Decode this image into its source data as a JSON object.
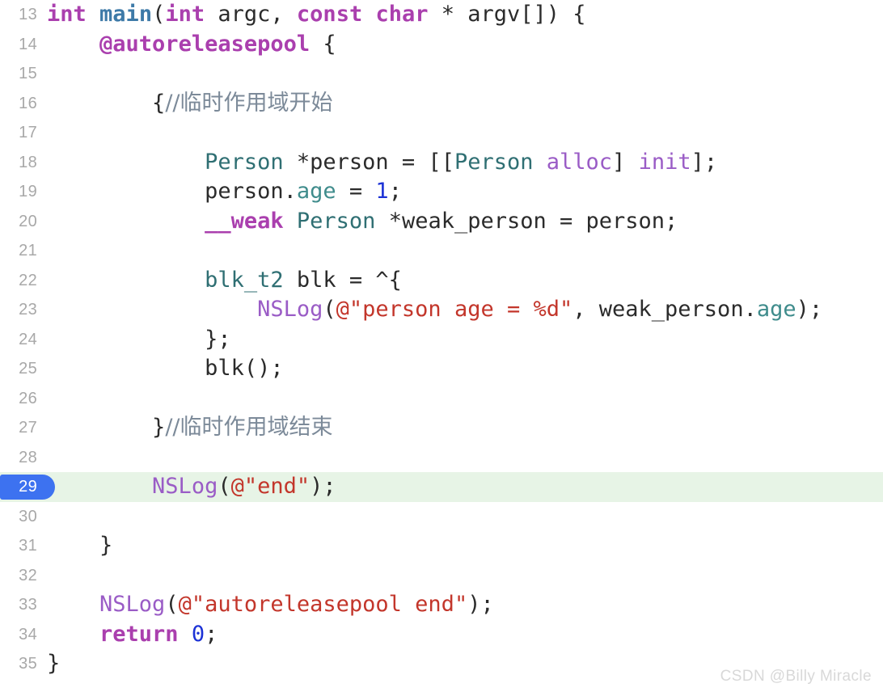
{
  "editor": {
    "language": "Objective-C",
    "first_line": 13,
    "highlighted_line": 29,
    "colors": {
      "background": "#ffffff",
      "highlight_row": "#e7f4e6",
      "breakpoint_badge": "#3d72f0",
      "gutter_text": "#a8a8a8",
      "keyword": "#aa3fae",
      "function_name": "#3e7aa8",
      "type": "#2f6f73",
      "property": "#3f8c8c",
      "message_selector": "#9a5cc6",
      "string": "#c3362b",
      "number": "#1c32d6",
      "comment": "#7c8a99",
      "plain_text": "#2b2b2b",
      "watermark": "#d8d8d8"
    }
  },
  "watermark": {
    "text": "CSDN @Billy Miracle"
  },
  "lines": [
    {
      "num": "13",
      "text": "int main(int argc, const char * argv[]) {"
    },
    {
      "num": "14",
      "text": "    @autoreleasepool {"
    },
    {
      "num": "15",
      "text": ""
    },
    {
      "num": "16",
      "text": "        {//临时作用域开始"
    },
    {
      "num": "17",
      "text": ""
    },
    {
      "num": "18",
      "text": "            Person *person = [[Person alloc] init];"
    },
    {
      "num": "19",
      "text": "            person.age = 1;"
    },
    {
      "num": "20",
      "text": "            __weak Person *weak_person = person;"
    },
    {
      "num": "21",
      "text": ""
    },
    {
      "num": "22",
      "text": "            blk_t2 blk = ^{"
    },
    {
      "num": "23",
      "text": "                NSLog(@\"person age = %d\", weak_person.age);"
    },
    {
      "num": "24",
      "text": "            };"
    },
    {
      "num": "25",
      "text": "            blk();"
    },
    {
      "num": "26",
      "text": ""
    },
    {
      "num": "27",
      "text": "        }//临时作用域结束"
    },
    {
      "num": "28",
      "text": ""
    },
    {
      "num": "29",
      "text": "        NSLog(@\"end\");",
      "highlighted": true
    },
    {
      "num": "30",
      "text": ""
    },
    {
      "num": "31",
      "text": "    }"
    },
    {
      "num": "32",
      "text": ""
    },
    {
      "num": "33",
      "text": "    NSLog(@\"autoreleasepool end\");"
    },
    {
      "num": "34",
      "text": "    return 0;"
    },
    {
      "num": "35",
      "text": "}"
    }
  ],
  "tokens": [
    {
      "num": "13",
      "parts": [
        {
          "t": "int",
          "c": "kw"
        },
        {
          "t": " ",
          "c": "plain"
        },
        {
          "t": "main",
          "c": "fnname"
        },
        {
          "t": "(",
          "c": "plain"
        },
        {
          "t": "int",
          "c": "kw"
        },
        {
          "t": " argc, ",
          "c": "plain"
        },
        {
          "t": "const",
          "c": "kw"
        },
        {
          "t": " ",
          "c": "plain"
        },
        {
          "t": "char",
          "c": "kw"
        },
        {
          "t": " * argv[]) {",
          "c": "plain"
        }
      ]
    },
    {
      "num": "14",
      "parts": [
        {
          "t": "    ",
          "c": "plain"
        },
        {
          "t": "@autoreleasepool",
          "c": "kw"
        },
        {
          "t": " {",
          "c": "plain"
        }
      ]
    },
    {
      "num": "15",
      "parts": []
    },
    {
      "num": "16",
      "parts": [
        {
          "t": "        ",
          "c": "plain"
        },
        {
          "t": "{",
          "c": "plain"
        },
        {
          "t": "//临时作用域开始",
          "c": "cmt"
        }
      ]
    },
    {
      "num": "17",
      "parts": []
    },
    {
      "num": "18",
      "parts": [
        {
          "t": "            ",
          "c": "plain"
        },
        {
          "t": "Person",
          "c": "type"
        },
        {
          "t": " *person = [[",
          "c": "plain"
        },
        {
          "t": "Person",
          "c": "type"
        },
        {
          "t": " ",
          "c": "plain"
        },
        {
          "t": "alloc",
          "c": "msg"
        },
        {
          "t": "] ",
          "c": "plain"
        },
        {
          "t": "init",
          "c": "msg"
        },
        {
          "t": "];",
          "c": "plain"
        }
      ]
    },
    {
      "num": "19",
      "parts": [
        {
          "t": "            person.",
          "c": "plain"
        },
        {
          "t": "age",
          "c": "prop"
        },
        {
          "t": " = ",
          "c": "plain"
        },
        {
          "t": "1",
          "c": "num"
        },
        {
          "t": ";",
          "c": "plain"
        }
      ]
    },
    {
      "num": "20",
      "parts": [
        {
          "t": "            ",
          "c": "plain"
        },
        {
          "t": "__weak",
          "c": "kw"
        },
        {
          "t": " ",
          "c": "plain"
        },
        {
          "t": "Person",
          "c": "type"
        },
        {
          "t": " *weak_person = person;",
          "c": "plain"
        }
      ]
    },
    {
      "num": "21",
      "parts": []
    },
    {
      "num": "22",
      "parts": [
        {
          "t": "            ",
          "c": "plain"
        },
        {
          "t": "blk_t2",
          "c": "type"
        },
        {
          "t": " blk = ^{",
          "c": "plain"
        }
      ]
    },
    {
      "num": "23",
      "parts": [
        {
          "t": "                ",
          "c": "plain"
        },
        {
          "t": "NSLog",
          "c": "msg"
        },
        {
          "t": "(",
          "c": "plain"
        },
        {
          "t": "@\"person age = %d\"",
          "c": "str"
        },
        {
          "t": ", weak_person.",
          "c": "plain"
        },
        {
          "t": "age",
          "c": "prop"
        },
        {
          "t": ");",
          "c": "plain"
        }
      ]
    },
    {
      "num": "24",
      "parts": [
        {
          "t": "            };",
          "c": "plain"
        }
      ]
    },
    {
      "num": "25",
      "parts": [
        {
          "t": "            blk();",
          "c": "plain"
        }
      ]
    },
    {
      "num": "26",
      "parts": []
    },
    {
      "num": "27",
      "parts": [
        {
          "t": "        ",
          "c": "plain"
        },
        {
          "t": "}",
          "c": "plain"
        },
        {
          "t": "//临时作用域结束",
          "c": "cmt"
        }
      ]
    },
    {
      "num": "28",
      "parts": []
    },
    {
      "num": "29",
      "parts": [
        {
          "t": "        ",
          "c": "plain"
        },
        {
          "t": "NSLog",
          "c": "msg"
        },
        {
          "t": "(",
          "c": "plain"
        },
        {
          "t": "@\"end\"",
          "c": "str"
        },
        {
          "t": ");",
          "c": "plain"
        }
      ]
    },
    {
      "num": "30",
      "parts": []
    },
    {
      "num": "31",
      "parts": [
        {
          "t": "    }",
          "c": "plain"
        }
      ]
    },
    {
      "num": "32",
      "parts": []
    },
    {
      "num": "33",
      "parts": [
        {
          "t": "    ",
          "c": "plain"
        },
        {
          "t": "NSLog",
          "c": "msg"
        },
        {
          "t": "(",
          "c": "plain"
        },
        {
          "t": "@\"autoreleasepool end\"",
          "c": "str"
        },
        {
          "t": ");",
          "c": "plain"
        }
      ]
    },
    {
      "num": "34",
      "parts": [
        {
          "t": "    ",
          "c": "plain"
        },
        {
          "t": "return",
          "c": "kw"
        },
        {
          "t": " ",
          "c": "plain"
        },
        {
          "t": "0",
          "c": "num"
        },
        {
          "t": ";",
          "c": "plain"
        }
      ]
    },
    {
      "num": "35",
      "parts": [
        {
          "t": "}",
          "c": "plain"
        }
      ]
    }
  ]
}
